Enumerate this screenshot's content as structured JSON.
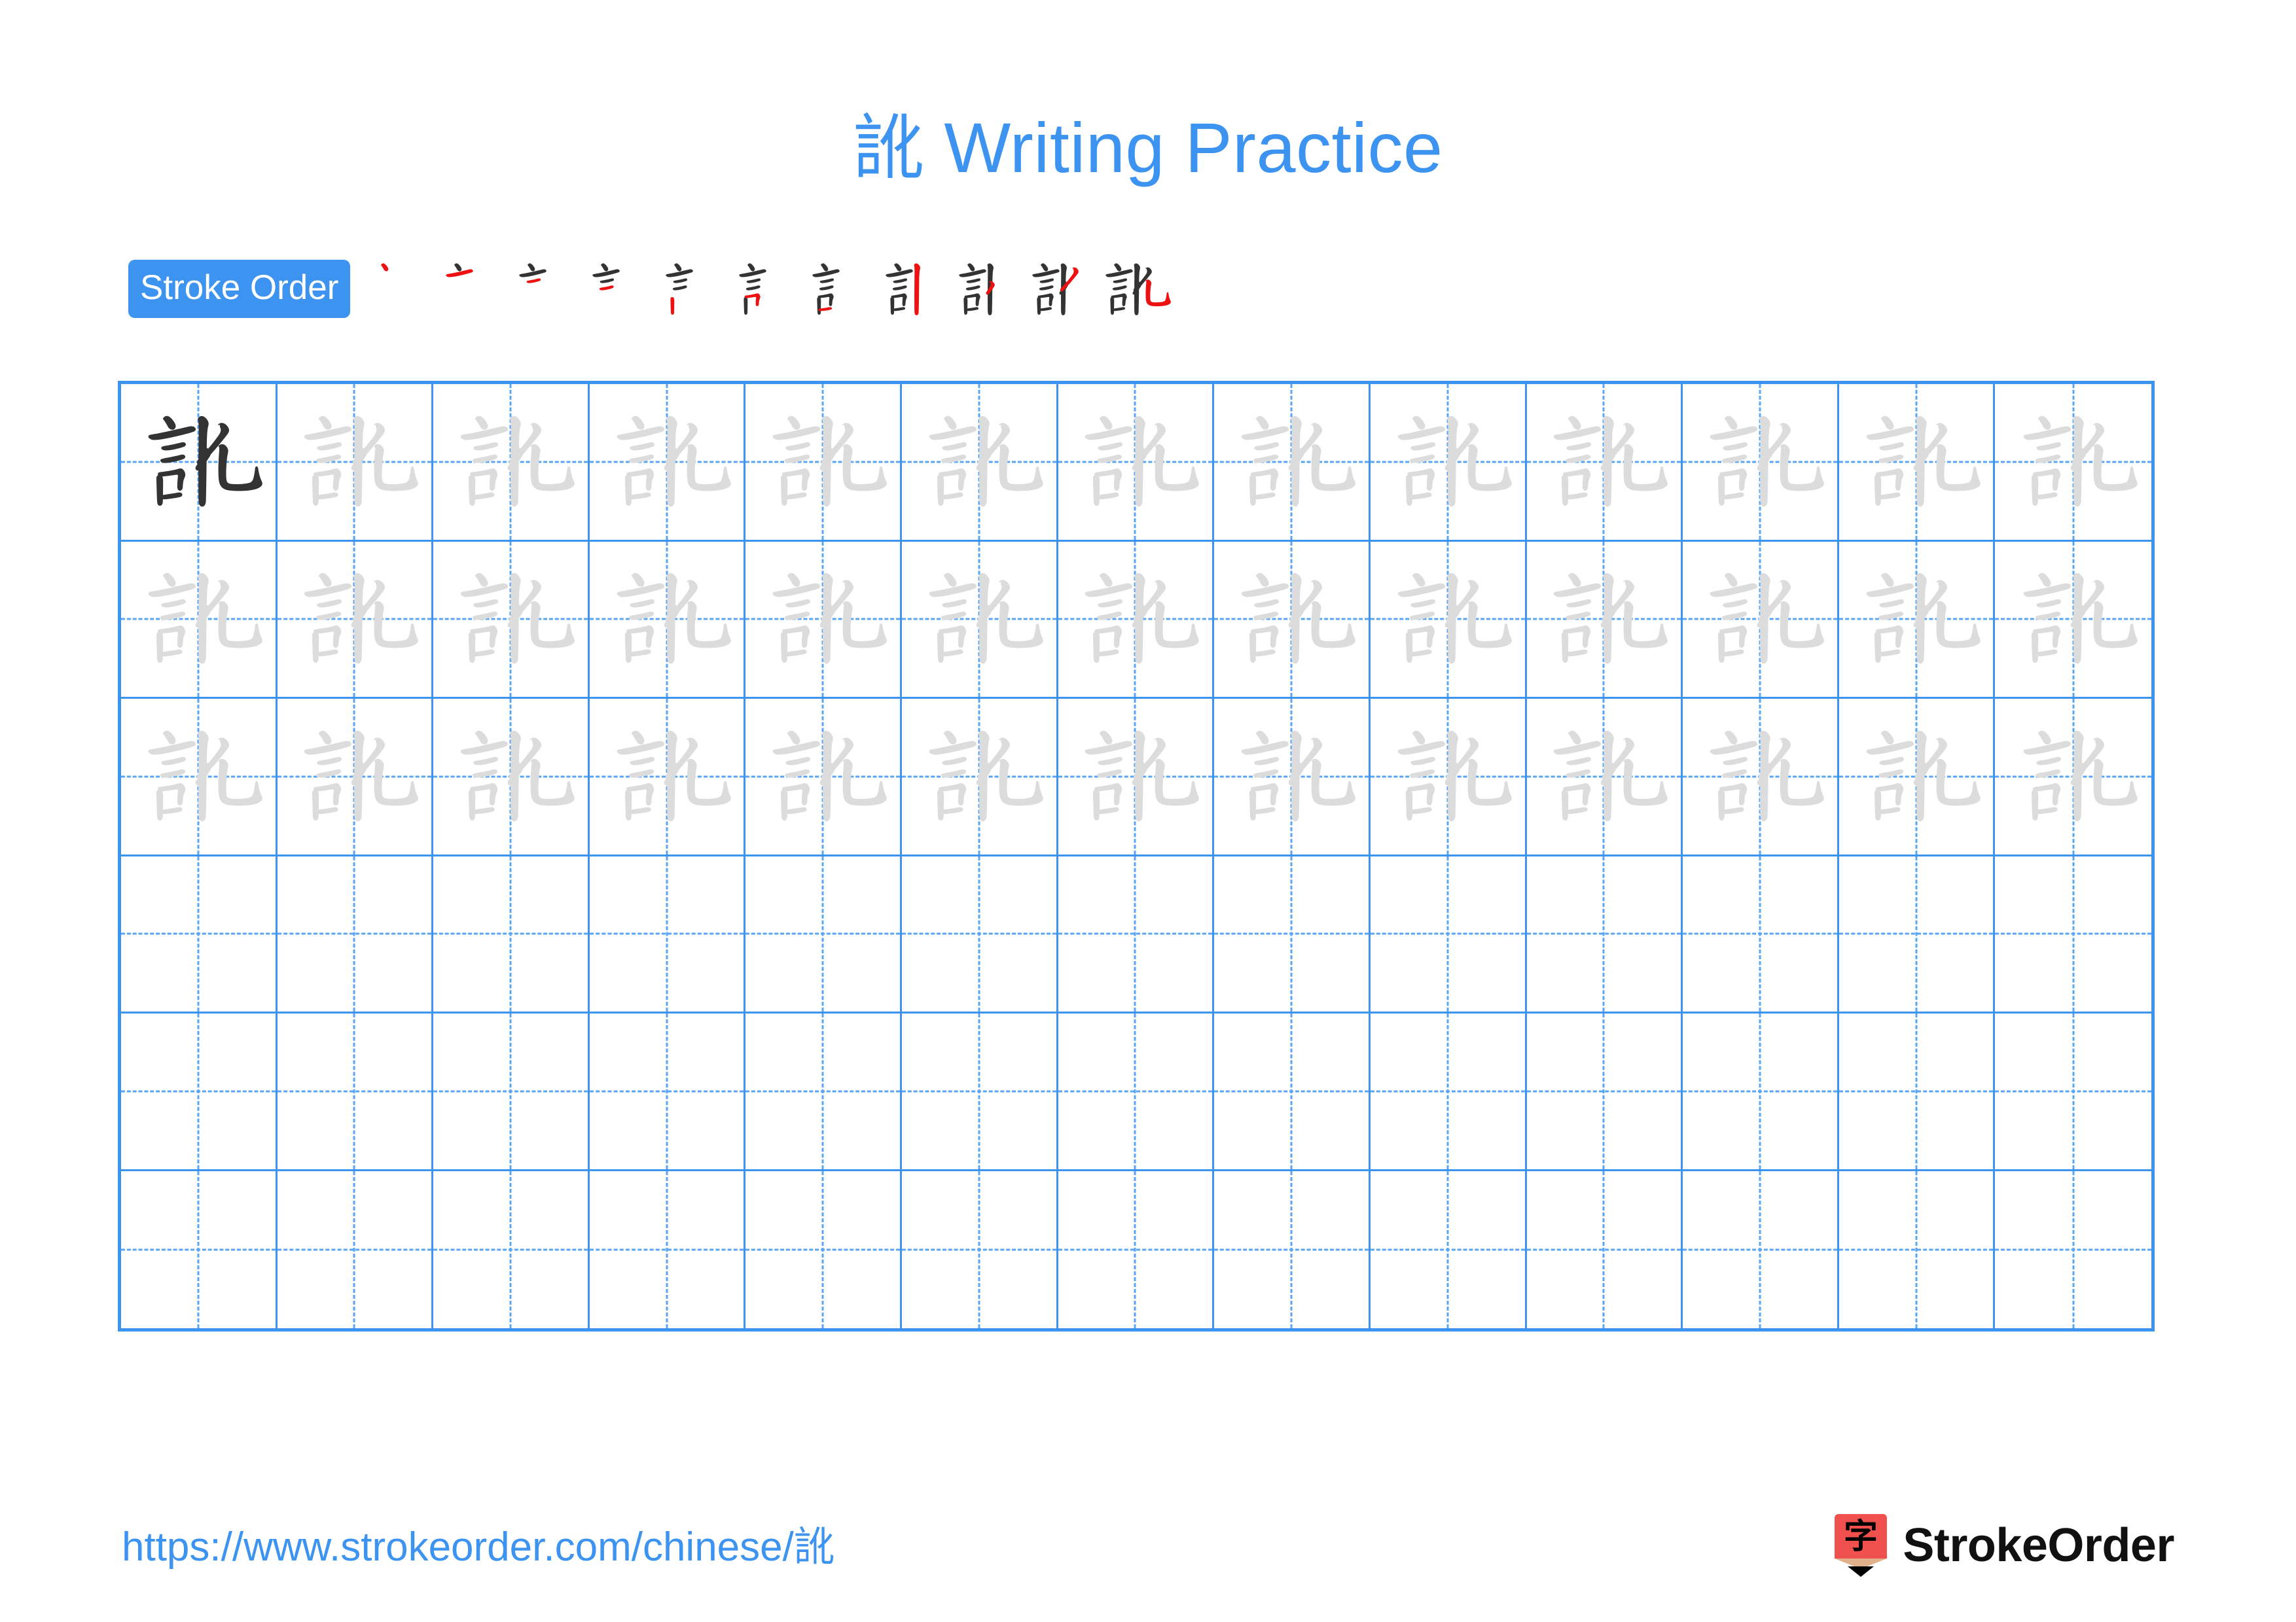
{
  "page": {
    "character": "訛",
    "title": "訛 Writing Practice",
    "background_color": "#ffffff",
    "accent_color": "#3d94f0",
    "ghost_color": "#dcdcdc",
    "ink_color": "#333333",
    "highlight_stroke_color": "#ee1111"
  },
  "stroke_order": {
    "badge_label": "Stroke Order",
    "total_strokes": 11,
    "steps": [
      {
        "index": 1,
        "strokes_shown": 1,
        "new_stroke_color": "#ee1111"
      },
      {
        "index": 2,
        "strokes_shown": 2,
        "new_stroke_color": "#ee1111"
      },
      {
        "index": 3,
        "strokes_shown": 3,
        "new_stroke_color": "#ee1111"
      },
      {
        "index": 4,
        "strokes_shown": 4,
        "new_stroke_color": "#ee1111"
      },
      {
        "index": 5,
        "strokes_shown": 5,
        "new_stroke_color": "#ee1111"
      },
      {
        "index": 6,
        "strokes_shown": 6,
        "new_stroke_color": "#ee1111"
      },
      {
        "index": 7,
        "strokes_shown": 7,
        "new_stroke_color": "#ee1111"
      },
      {
        "index": 8,
        "strokes_shown": 8,
        "new_stroke_color": "#ee1111"
      },
      {
        "index": 9,
        "strokes_shown": 9,
        "new_stroke_color": "#ee1111"
      },
      {
        "index": 10,
        "strokes_shown": 10,
        "new_stroke_color": "#ee1111"
      },
      {
        "index": 11,
        "strokes_shown": 11,
        "new_stroke_color": "#ee1111"
      }
    ]
  },
  "practice_grid": {
    "columns": 13,
    "rows": 6,
    "border_color": "#3d94f0",
    "guide_color": "#5aa6f5",
    "guide_style": "dashed-crosshair",
    "cells": [
      [
        "ink",
        "ghost",
        "ghost",
        "ghost",
        "ghost",
        "ghost",
        "ghost",
        "ghost",
        "ghost",
        "ghost",
        "ghost",
        "ghost",
        "ghost"
      ],
      [
        "ghost",
        "ghost",
        "ghost",
        "ghost",
        "ghost",
        "ghost",
        "ghost",
        "ghost",
        "ghost",
        "ghost",
        "ghost",
        "ghost",
        "ghost"
      ],
      [
        "ghost",
        "ghost",
        "ghost",
        "ghost",
        "ghost",
        "ghost",
        "ghost",
        "ghost",
        "ghost",
        "ghost",
        "ghost",
        "ghost",
        "ghost"
      ],
      [
        "empty",
        "empty",
        "empty",
        "empty",
        "empty",
        "empty",
        "empty",
        "empty",
        "empty",
        "empty",
        "empty",
        "empty",
        "empty"
      ],
      [
        "empty",
        "empty",
        "empty",
        "empty",
        "empty",
        "empty",
        "empty",
        "empty",
        "empty",
        "empty",
        "empty",
        "empty",
        "empty"
      ],
      [
        "empty",
        "empty",
        "empty",
        "empty",
        "empty",
        "empty",
        "empty",
        "empty",
        "empty",
        "empty",
        "empty",
        "empty",
        "empty"
      ]
    ]
  },
  "footer": {
    "url": "https://www.strokeorder.com/chinese/訛",
    "logo_text": "StrokeOrder",
    "logo_icon": "pencil-zi-icon",
    "logo_body_color": "#f0514e",
    "logo_tip_color": "#e0b18b",
    "logo_point_color": "#000000",
    "logo_glyph": "字"
  }
}
